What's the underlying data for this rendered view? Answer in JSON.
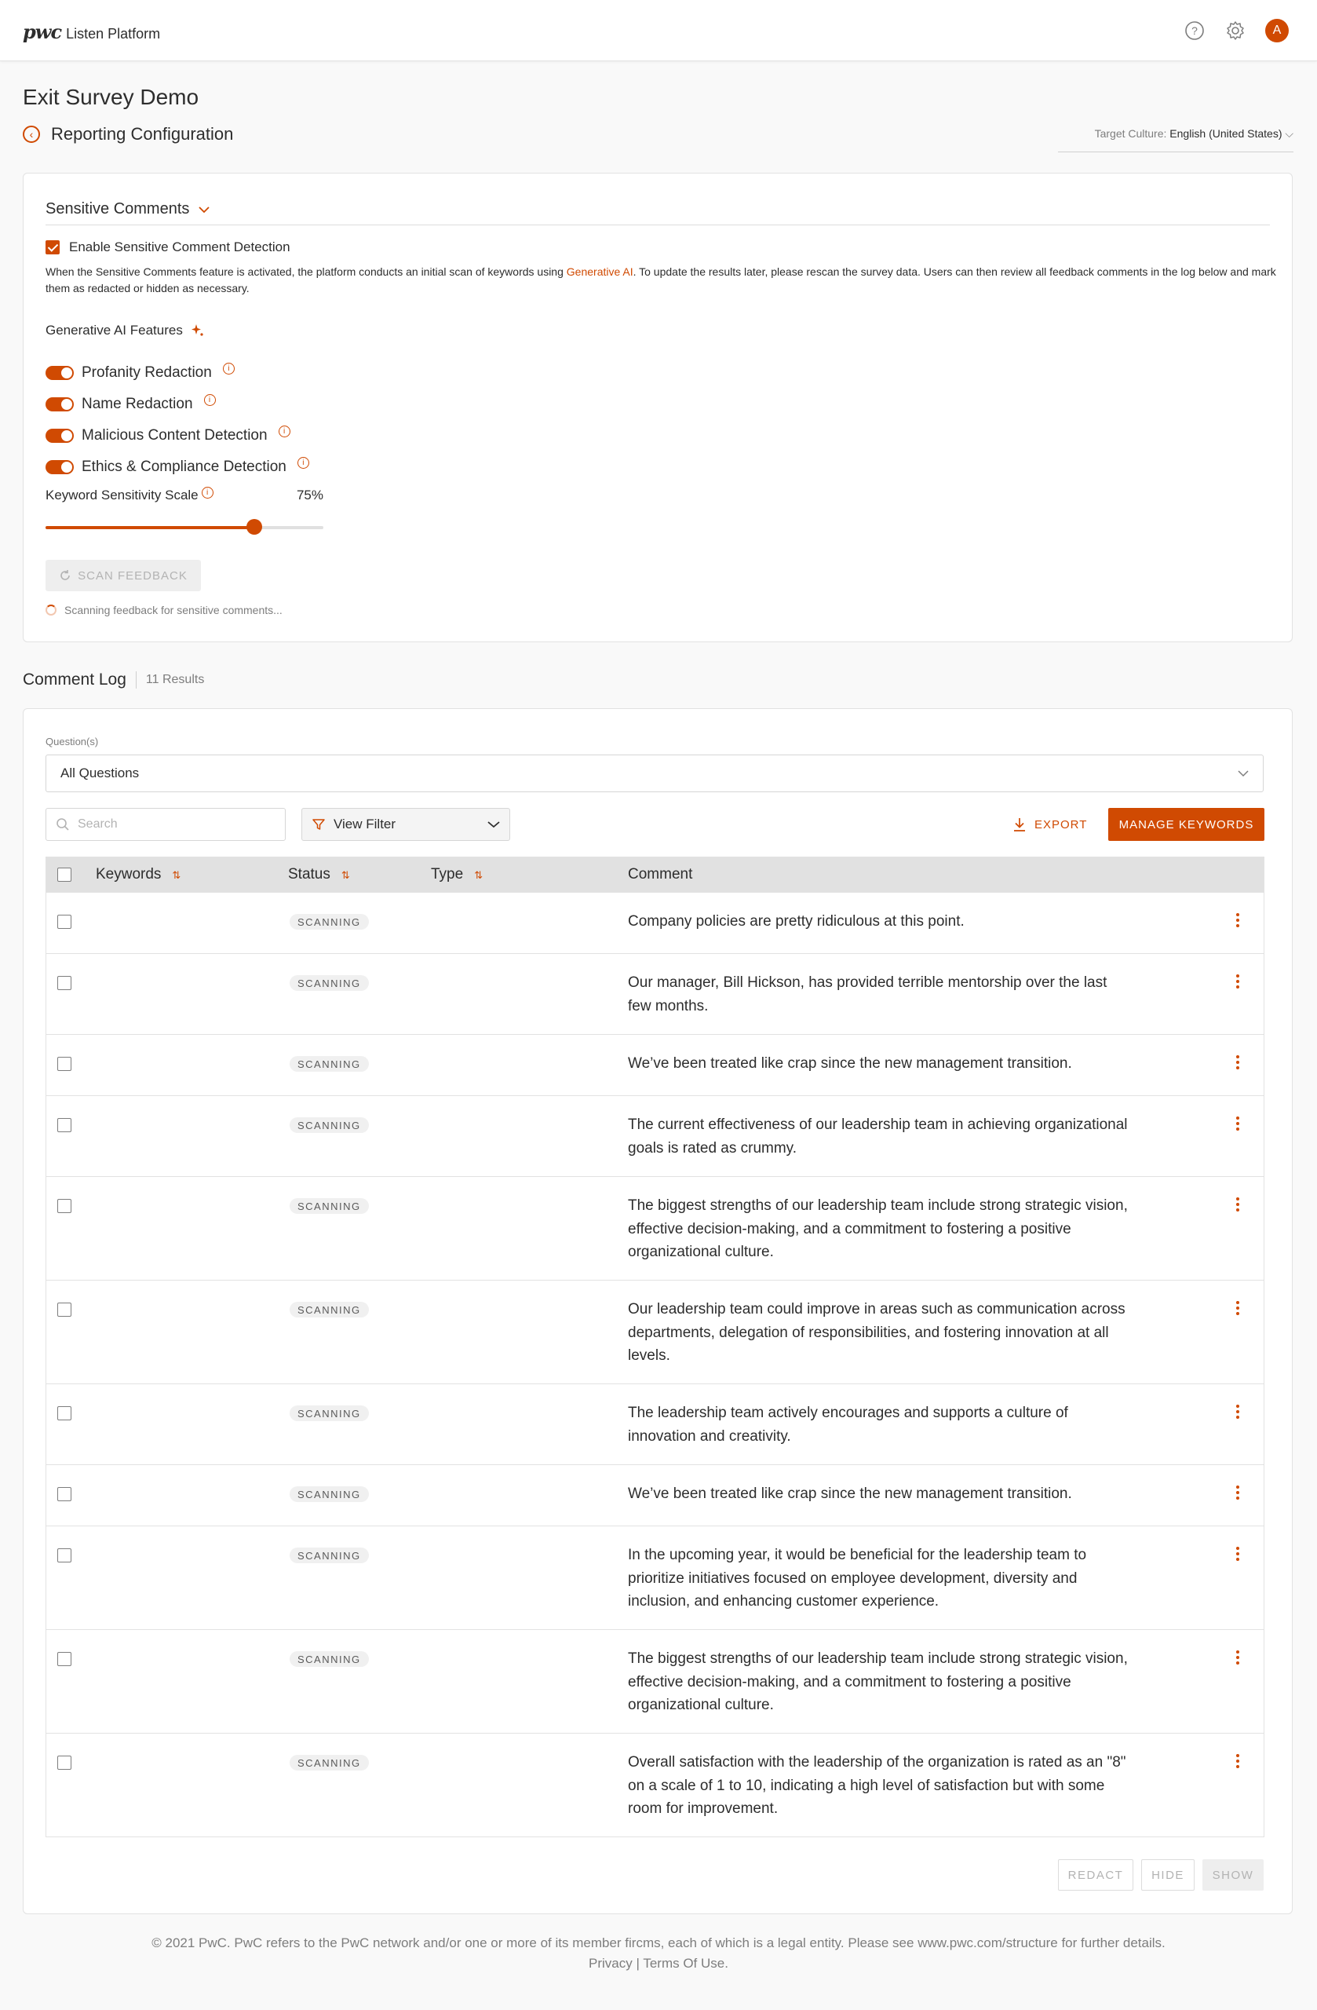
{
  "header": {
    "logo_mark": "pwc",
    "app_name": "Listen Platform",
    "avatar_initial": "A",
    "icons": [
      "help-icon",
      "gear-icon"
    ]
  },
  "page": {
    "title": "Exit Survey Demo",
    "subtitle": "Reporting Configuration",
    "culture_label": "Target Culture:",
    "culture_value": "English (United States)"
  },
  "sensitive": {
    "section_title": "Sensitive Comments",
    "enable_label": "Enable Sensitive Comment Detection",
    "enable_checked": true,
    "desc_before": "When the Sensitive Comments feature is activated, the platform conducts an initial scan of keywords using ",
    "desc_link": "Generative AI",
    "desc_after": ". To update the results later, please rescan the survey data. Users can then review all feedback comments in the log below and mark them as redacted or hidden as necessary.",
    "gen_ai_title": "Generative AI Features",
    "features": [
      {
        "label": "Profanity Redaction",
        "on": true
      },
      {
        "label": "Name Redaction",
        "on": true
      },
      {
        "label": "Malicious Content Detection",
        "on": true
      },
      {
        "label": "Ethics & Compliance Detection",
        "on": true
      }
    ],
    "sensitivity_label": "Keyword Sensitivity Scale",
    "sensitivity_value": "75%",
    "sensitivity_level": 0.75,
    "scan_button": "SCAN FEEDBACK",
    "scan_status": "Scanning feedback for sensitive comments..."
  },
  "log": {
    "title": "Comment Log",
    "count": "11 Results",
    "question_label": "Question(s)",
    "question_value": "All Questions",
    "search_placeholder": "Search",
    "view_filter": "View Filter",
    "export_label": "EXPORT",
    "manage_label": "MANAGE KEYWORDS",
    "columns": {
      "keywords": "Keywords",
      "status": "Status",
      "type": "Type",
      "comment": "Comment"
    },
    "rows": [
      {
        "status": "SCANNING",
        "comment": "Company policies are pretty ridiculous at this point."
      },
      {
        "status": "SCANNING",
        "comment": "Our manager, Bill Hickson, has provided terrible mentorship over the last few months."
      },
      {
        "status": "SCANNING",
        "comment": "We’ve been treated like crap since the new management transition."
      },
      {
        "status": "SCANNING",
        "comment": "The current effectiveness of our leadership team in achieving organizational goals is rated as crummy."
      },
      {
        "status": "SCANNING",
        "comment": "The biggest strengths of our leadership team include strong strategic vision, effective decision-making, and a commitment to fostering a positive organizational culture."
      },
      {
        "status": "SCANNING",
        "comment": "Our leadership team could improve in areas such as communication across departments, delegation of responsibilities, and fostering innovation at all levels."
      },
      {
        "status": "SCANNING",
        "comment": "The leadership team actively encourages and supports a culture of innovation and creativity."
      },
      {
        "status": "SCANNING",
        "comment": "We’ve been treated like crap since the new management transition."
      },
      {
        "status": "SCANNING",
        "comment": "In the upcoming year, it would be beneficial for the leadership team to prioritize initiatives focused on employee development, diversity and inclusion, and enhancing customer experience."
      },
      {
        "status": "SCANNING",
        "comment": "The biggest strengths of our leadership team include strong strategic vision, effective decision-making, and a commitment to fostering a positive organizational culture."
      },
      {
        "status": "SCANNING",
        "comment": "Overall satisfaction with the leadership of the organization is rated as an \"8\" on a scale of 1 to 10, indicating a high level of satisfaction but with some room for improvement."
      }
    ],
    "actions": {
      "redact": "REDACT",
      "hide": "HIDE",
      "show": "SHOW"
    }
  },
  "footer": {
    "text": "© 2021 PwC. PwC refers to the PwC network and/or one or more of its member fircms, each of which is a legal entity. Please see www.pwc.com/structure for further details.",
    "privacy": "Privacy",
    "terms": "Terms Of Use."
  }
}
